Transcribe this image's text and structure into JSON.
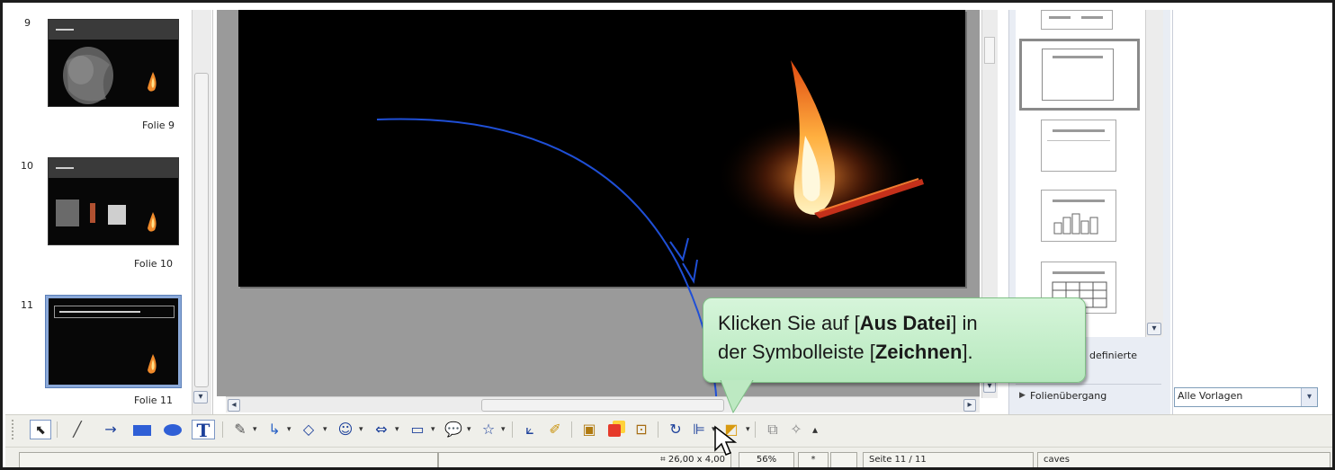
{
  "slides_panel": {
    "items": [
      {
        "number": "9",
        "label": "Folie 9"
      },
      {
        "number": "10",
        "label": "Folie 10"
      },
      {
        "number": "11",
        "label": "Folie 11"
      }
    ]
  },
  "layout_panel": {
    "section_partial_label": "definierte",
    "transition_label": "Folienübergang"
  },
  "styles_panel": {
    "select_value": "Alle Vorlagen"
  },
  "status_bar": {
    "size": "26,00 x 4,00",
    "zoom": "56%",
    "modified": "*",
    "page": "Seite 11 / 11",
    "master": "caves"
  },
  "callout": {
    "line1_pre": "Klicken Sie auf [",
    "line1_bold": "Aus Datei",
    "line1_post": "] in",
    "line2_pre": "der Symbolleiste [",
    "line2_bold": "Zeichnen",
    "line2_post": "]."
  },
  "colors": {
    "callout_bg": "#c6efcb",
    "motion_path": "#1f4fd6",
    "selection": "#8aa8d8"
  },
  "toolbar_icons": [
    "select-icon",
    "line-icon",
    "arrow-icon",
    "rectangle-icon",
    "ellipse-icon",
    "text-icon",
    "curve-icon",
    "connector-icon",
    "basic-shapes-icon",
    "symbol-shapes-icon",
    "block-arrows-icon",
    "flowchart-icon",
    "callouts-icon",
    "stars-icon",
    "points-icon",
    "glue-points-icon",
    "fontwork-icon",
    "from-file-icon",
    "gallery-icon",
    "rotate-icon",
    "alignment-icon",
    "arrange-icon",
    "extrusion-icon",
    "3d-icon"
  ]
}
